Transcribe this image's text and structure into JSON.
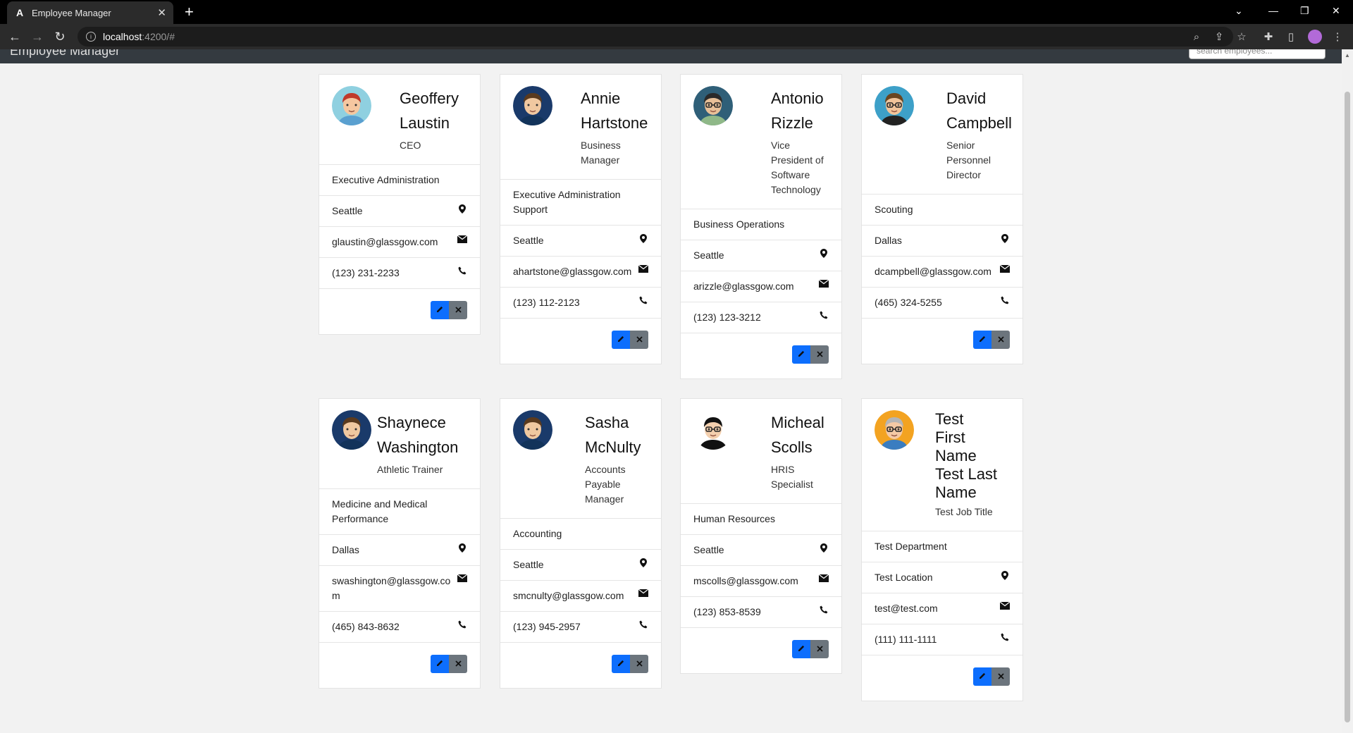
{
  "browser": {
    "tab_title": "Employee Manager",
    "tab_icon": "A",
    "url_host": "localhost",
    "url_path": ":4200/#"
  },
  "app": {
    "brand": "Employee Manager",
    "search_placeholder": "search employees..."
  },
  "employees": [
    {
      "name_lines": [
        "Geoffery",
        "Laustin"
      ],
      "job": "CEO",
      "department": "Executive Administration",
      "location": "Seattle",
      "email": "glaustin@glassgow.com",
      "phone": "(123) 231-2233",
      "avatar": "red-haired-man-avatar"
    },
    {
      "name_lines": [
        "Annie",
        "Hartstone"
      ],
      "job": "Business Manager",
      "department": "Executive Administration Support",
      "location": "Seattle",
      "email": "ahartstone@glassgow.com",
      "phone": "(123) 112-2123",
      "avatar": "brown-haired-woman-avatar"
    },
    {
      "name_lines": [
        "Antonio",
        "Rizzle"
      ],
      "job": "Vice President of Software Technology",
      "department": "Business Operations",
      "location": "Seattle",
      "email": "arizzle@glassgow.com",
      "phone": "(123) 123-3212",
      "avatar": "man-with-glasses-avatar"
    },
    {
      "name_lines": [
        "David",
        "Campbell"
      ],
      "job": "Senior Personnel Director",
      "department": "Scouting",
      "location": "Dallas",
      "email": "dcampbell@glassgow.com",
      "phone": "(465) 324-5255",
      "avatar": "bearded-man-sunglasses-avatar"
    },
    {
      "name_lines": [
        "Shaynece",
        "Washington"
      ],
      "job": "Athletic Trainer",
      "department": "Medicine and Medical Performance",
      "location": "Dallas",
      "email": "swashington@glassgow.com",
      "phone": "(465) 843-8632",
      "avatar": "brown-haired-woman-avatar"
    },
    {
      "name_lines": [
        "Sasha",
        "McNulty"
      ],
      "job": "Accounts Payable Manager",
      "department": "Accounting",
      "location": "Seattle",
      "email": "smcnulty@glassgow.com",
      "phone": "(123) 945-2957",
      "avatar": "brown-haired-woman-avatar"
    },
    {
      "name_lines": [
        "Micheal",
        "Scolls"
      ],
      "job": "HRIS Specialist",
      "department": "Human Resources",
      "location": "Seattle",
      "email": "mscolls@glassgow.com",
      "phone": "(123) 853-8539",
      "avatar": "man-with-glasses-black-hair-avatar"
    },
    {
      "name_lines": [
        "Test",
        "First",
        "Name",
        "Test Last",
        "Name"
      ],
      "job": "Test Job Title",
      "department": "Test Department",
      "location": "Test Location",
      "email": "test@test.com",
      "phone": "(111) 111-1111",
      "avatar": "man-glasses-orange-avatar"
    }
  ]
}
